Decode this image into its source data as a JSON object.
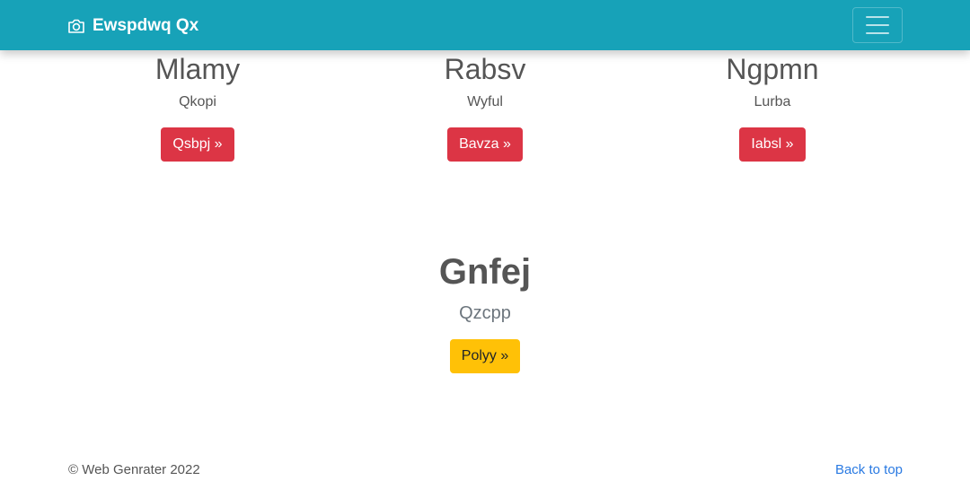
{
  "navbar": {
    "brand": "Ewspdwq Qx",
    "brand_icon": "camera-icon",
    "toggle_icon": "hamburger-menu-icon",
    "color": "#17a2b8"
  },
  "features": [
    {
      "title": "Mlamy",
      "text": "Qkopi",
      "button": "Qsbpj »"
    },
    {
      "title": "Rabsv",
      "text": "Wyful",
      "button": "Bavza »"
    },
    {
      "title": "Ngpmn",
      "text": "Lurba",
      "button": "Iabsl »"
    }
  ],
  "hero": {
    "title": "Gnfej",
    "subtitle": "Qzcpp",
    "button": "Polyy »"
  },
  "footer": {
    "copyright": "© Web Genrater 2022",
    "back_to_top": "Back to top"
  },
  "colors": {
    "danger": "#dc3545",
    "warning": "#ffc107",
    "link": "#2a7ae2"
  }
}
